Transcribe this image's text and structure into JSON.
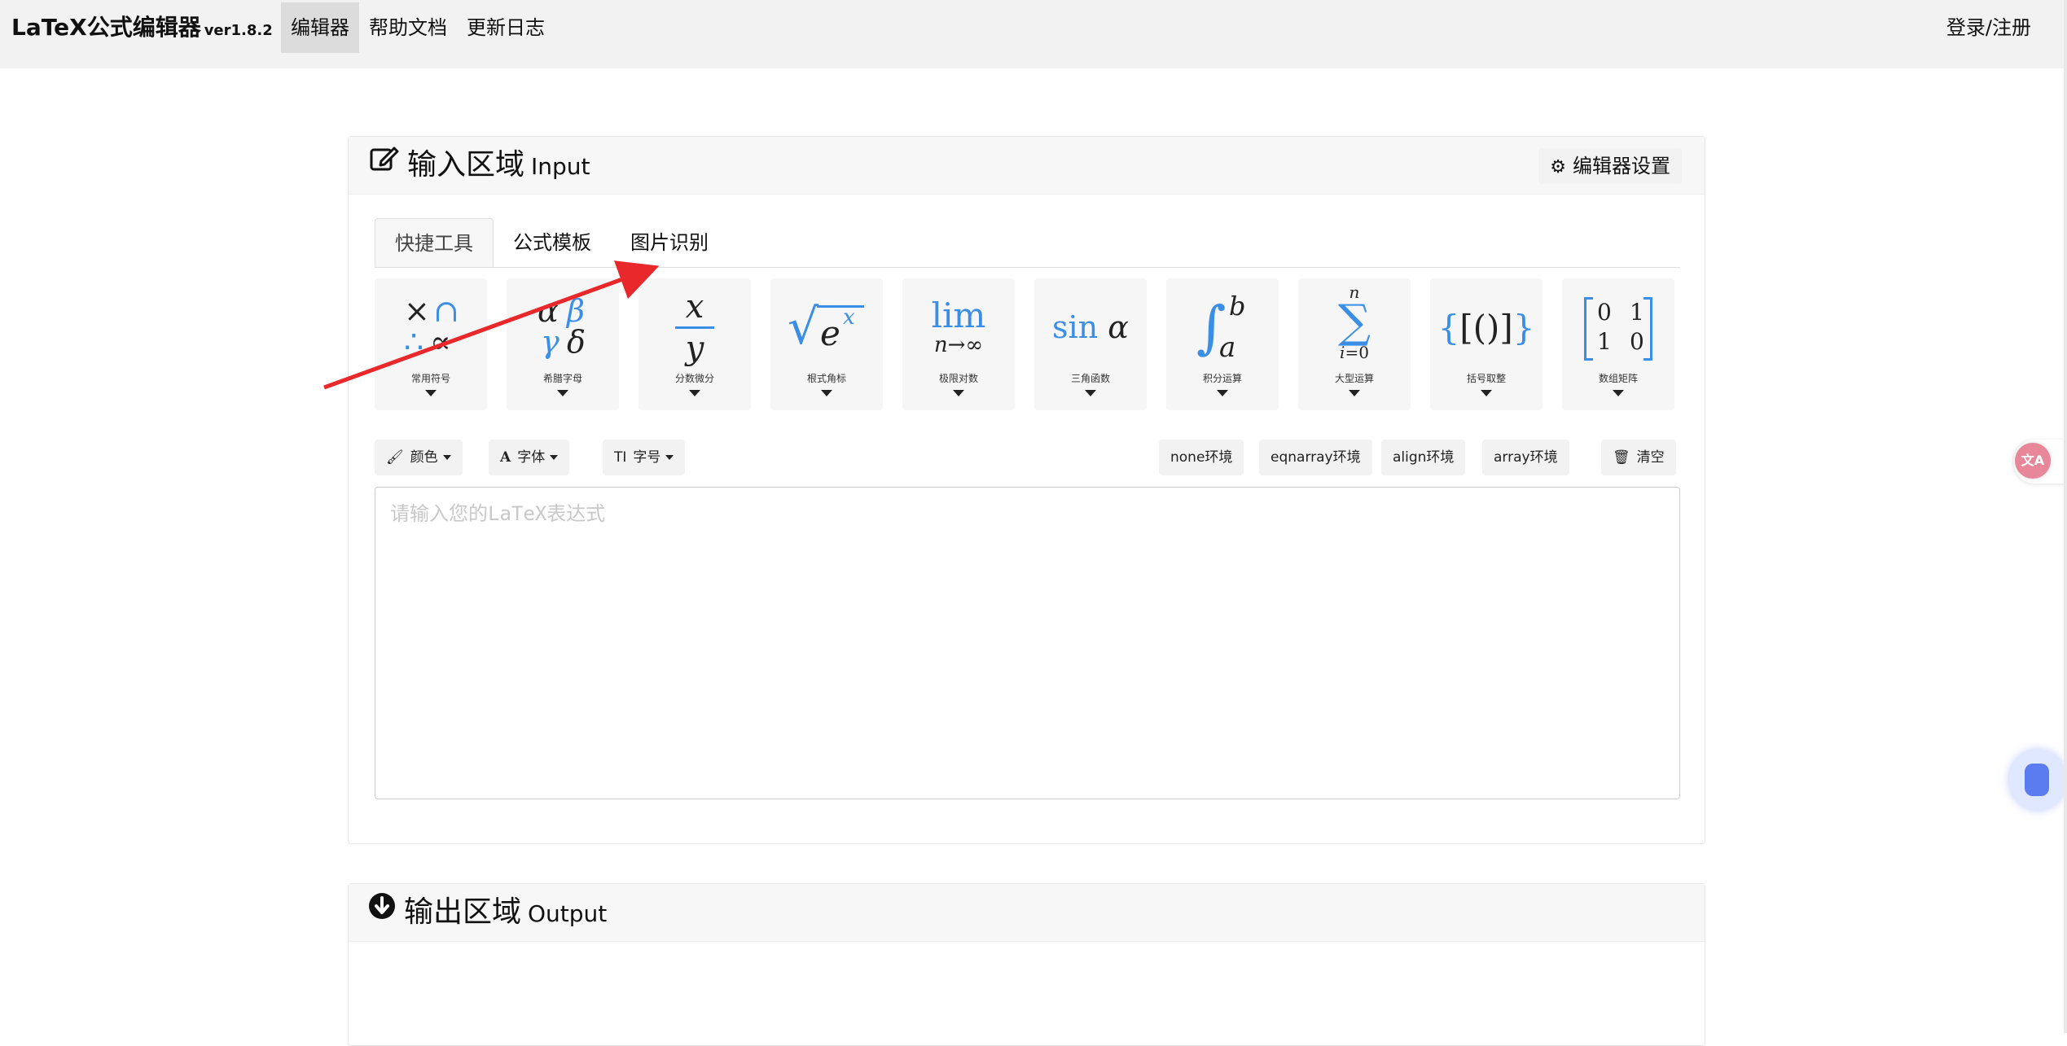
{
  "navbar": {
    "brand": "LaTeX公式编辑器",
    "version": "ver1.8.2",
    "items": [
      "编辑器",
      "帮助文档",
      "更新日志"
    ],
    "active_item": "编辑器",
    "login": "登录/注册"
  },
  "input_panel": {
    "title_zh": "输入区域",
    "title_en": "Input",
    "settings_label": "编辑器设置",
    "tabs": [
      "快捷工具",
      "公式模板",
      "图片识别"
    ],
    "active_tab": "快捷工具",
    "cards": [
      {
        "label": "常用符号",
        "icon": "common-symbols-icon"
      },
      {
        "label": "希腊字母",
        "icon": "greek-letters-icon"
      },
      {
        "label": "分数微分",
        "icon": "fraction-icon"
      },
      {
        "label": "根式角标",
        "icon": "radical-icon"
      },
      {
        "label": "极限对数",
        "icon": "limit-icon"
      },
      {
        "label": "三角函数",
        "icon": "trig-icon"
      },
      {
        "label": "积分运算",
        "icon": "integral-icon"
      },
      {
        "label": "大型运算",
        "icon": "sum-icon"
      },
      {
        "label": "括号取整",
        "icon": "brackets-icon"
      },
      {
        "label": "数组矩阵",
        "icon": "matrix-icon"
      }
    ],
    "toolbar": {
      "color": "颜色",
      "font": "字体",
      "font_icon": "A",
      "size": "字号",
      "size_icon": "TI",
      "envs": [
        "none环境",
        "eqnarray环境",
        "align环境",
        "array环境"
      ],
      "clear": "清空"
    },
    "editor_placeholder": "请输入您的LaTeX表达式",
    "editor_value": ""
  },
  "output_panel": {
    "title_zh": "输出区域",
    "title_en": "Output"
  },
  "floating": {
    "translate_label": "文A",
    "accent_color": "#3a8ee6",
    "annotation_arrow_color": "#e8282b"
  }
}
